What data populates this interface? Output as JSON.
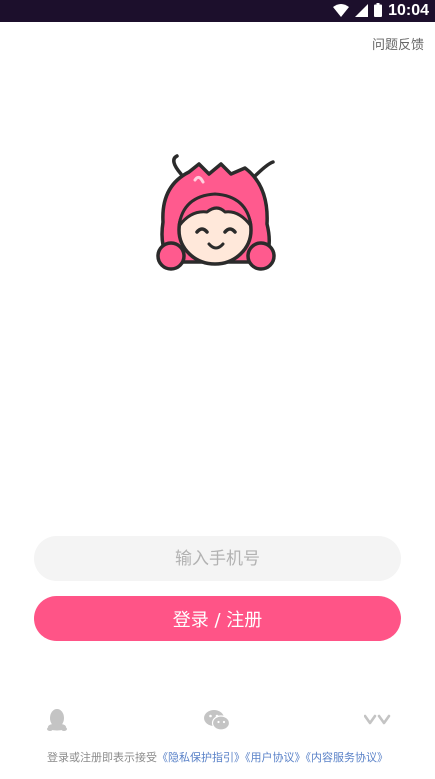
{
  "status_bar": {
    "time": "10:04",
    "icons": [
      "wifi-icon",
      "signal-icon",
      "battery-icon"
    ]
  },
  "header": {
    "feedback_label": "问题反馈"
  },
  "logo": {
    "icon": "lobster-girl-mascot-icon"
  },
  "form": {
    "phone_placeholder": "输入手机号",
    "phone_value": "",
    "submit_label": "登录 / 注册"
  },
  "social_login": {
    "items": [
      {
        "icon": "qq-icon"
      },
      {
        "icon": "wechat-icon"
      },
      {
        "icon": "yy-icon"
      }
    ]
  },
  "agreement": {
    "prefix": "登录或注册即表示接受",
    "privacy_link": "《隐私保护指引》",
    "user_link": "《用户协议》",
    "content_link": "《内容服务协议》"
  },
  "colors": {
    "accent": "#ff5487",
    "status_bar_bg": "#1c0f2c",
    "input_bg": "#f4f4f4",
    "link": "#5a82c8"
  }
}
